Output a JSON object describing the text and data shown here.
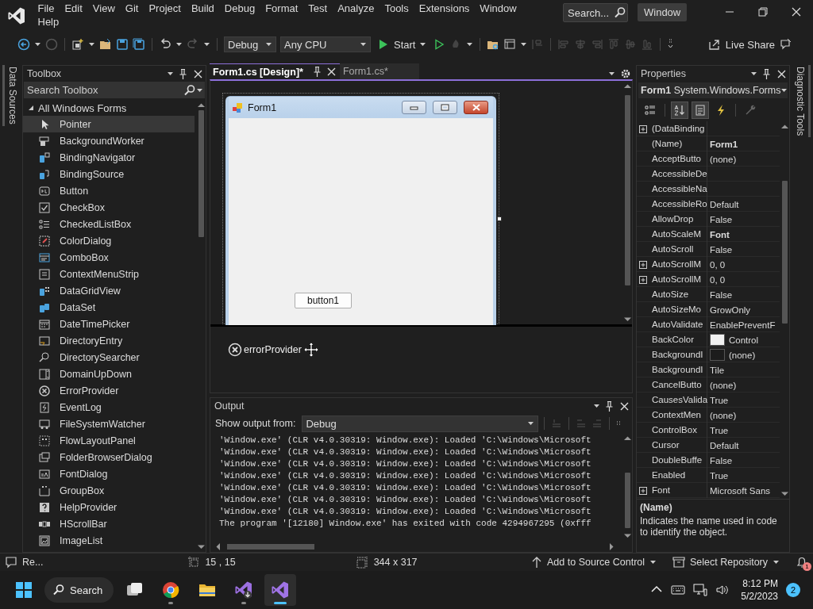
{
  "menu": [
    "File",
    "Edit",
    "View",
    "Git",
    "Project",
    "Build",
    "Debug",
    "Format",
    "Test",
    "Analyze",
    "Tools",
    "Extensions",
    "Window",
    "Help"
  ],
  "search": {
    "placeholder": "Search..."
  },
  "window_title": "Window",
  "toolbar": {
    "configuration": "Debug",
    "platform": "Any CPU",
    "start": "Start",
    "live_share": "Live Share"
  },
  "left_side_tabs": [
    "Data Sources"
  ],
  "right_side_tabs": [
    "Diagnostic Tools"
  ],
  "toolbox": {
    "title": "Toolbox",
    "search": {
      "placeholder": "Search Toolbox"
    },
    "group": {
      "label": "All Windows Forms",
      "expanded": true
    },
    "items": [
      {
        "label": "Pointer",
        "selected": true
      },
      {
        "label": "BackgroundWorker",
        "selected": false
      },
      {
        "label": "BindingNavigator",
        "selected": false
      },
      {
        "label": "BindingSource",
        "selected": false
      },
      {
        "label": "Button",
        "selected": false
      },
      {
        "label": "CheckBox",
        "selected": false
      },
      {
        "label": "CheckedListBox",
        "selected": false
      },
      {
        "label": "ColorDialog",
        "selected": false
      },
      {
        "label": "ComboBox",
        "selected": false
      },
      {
        "label": "ContextMenuStrip",
        "selected": false
      },
      {
        "label": "DataGridView",
        "selected": false
      },
      {
        "label": "DataSet",
        "selected": false
      },
      {
        "label": "DateTimePicker",
        "selected": false
      },
      {
        "label": "DirectoryEntry",
        "selected": false
      },
      {
        "label": "DirectorySearcher",
        "selected": false
      },
      {
        "label": "DomainUpDown",
        "selected": false
      },
      {
        "label": "ErrorProvider",
        "selected": false
      },
      {
        "label": "EventLog",
        "selected": false
      },
      {
        "label": "FileSystemWatcher",
        "selected": false
      },
      {
        "label": "FlowLayoutPanel",
        "selected": false
      },
      {
        "label": "FolderBrowserDialog",
        "selected": false
      },
      {
        "label": "FontDialog",
        "selected": false
      },
      {
        "label": "GroupBox",
        "selected": false
      },
      {
        "label": "HelpProvider",
        "selected": false
      },
      {
        "label": "HScrollBar",
        "selected": false
      },
      {
        "label": "ImageList",
        "selected": false
      }
    ]
  },
  "document_tabs": [
    {
      "label": "Form1.cs [Design]*",
      "selected": true
    },
    {
      "label": "Form1.cs*",
      "selected": false
    }
  ],
  "designer": {
    "form": {
      "title": "Form1",
      "button": "button1"
    },
    "components": [
      "errorProvider"
    ]
  },
  "output": {
    "title": "Output",
    "show_from_label": "Show output from:",
    "source": "Debug",
    "lines": [
      "'Window.exe' (CLR v4.0.30319: Window.exe): Loaded 'C:\\Windows\\Microsoft",
      "'Window.exe' (CLR v4.0.30319: Window.exe): Loaded 'C:\\Windows\\Microsoft",
      "'Window.exe' (CLR v4.0.30319: Window.exe): Loaded 'C:\\Windows\\Microsoft",
      "'Window.exe' (CLR v4.0.30319: Window.exe): Loaded 'C:\\Windows\\Microsoft",
      "'Window.exe' (CLR v4.0.30319: Window.exe): Loaded 'C:\\Windows\\Microsoft",
      "'Window.exe' (CLR v4.0.30319: Window.exe): Loaded 'C:\\Windows\\Microsoft",
      "'Window.exe' (CLR v4.0.30319: Window.exe): Loaded 'C:\\Windows\\Microsoft",
      "The program '[12180] Window.exe' has exited with code 4294967295 (0xfff"
    ]
  },
  "properties": {
    "title": "Properties",
    "object": "**Form1** System.Windows.Forms",
    "views": [
      {
        "kind": "categorized",
        "selected": false
      },
      {
        "kind": "alphabetical",
        "selected": true
      },
      {
        "kind": "properties",
        "selected": true
      },
      {
        "kind": "events",
        "selected": false
      },
      {
        "kind": "property-pages",
        "selected": false
      }
    ],
    "rows": [
      {
        "name": "(DataBinding",
        "value": "",
        "expandable": true
      },
      {
        "name": "(Name)",
        "value": "Form1",
        "expandable": false,
        "bold": true
      },
      {
        "name": "AcceptButto",
        "value": "(none)",
        "expandable": false,
        "bold": false
      },
      {
        "name": "AccessibleDe",
        "value": "",
        "expandable": false
      },
      {
        "name": "AccessibleNa",
        "value": "",
        "expandable": false
      },
      {
        "name": "AccessibleRo",
        "value": "Default",
        "expandable": false,
        "bold": false
      },
      {
        "name": "AllowDrop",
        "value": "False",
        "expandable": false,
        "bold": false
      },
      {
        "name": "AutoScaleM",
        "value": "Font",
        "expandable": false,
        "bold": true
      },
      {
        "name": "AutoScroll",
        "value": "False",
        "expandable": false,
        "bold": false
      },
      {
        "name": "AutoScrollM",
        "value": "0, 0",
        "expandable": true,
        "bold": false
      },
      {
        "name": "AutoScrollM",
        "value": "0, 0",
        "expandable": true,
        "bold": false
      },
      {
        "name": "AutoSize",
        "value": "False",
        "expandable": false,
        "bold": false
      },
      {
        "name": "AutoSizeMo",
        "value": "GrowOnly",
        "expandable": false,
        "bold": false
      },
      {
        "name": "AutoValidate",
        "value": "EnablePreventF",
        "expandable": false,
        "bold": false
      },
      {
        "name": "BackColor",
        "value": "Control",
        "expandable": false,
        "bold": false,
        "color": "#f0f0f0"
      },
      {
        "name": "BackgroundI",
        "value": "(none)",
        "expandable": false,
        "bold": false,
        "color": "#1c1c1c"
      },
      {
        "name": "BackgroundI",
        "value": "Tile",
        "expandable": false,
        "bold": false
      },
      {
        "name": "CancelButto",
        "value": "(none)",
        "expandable": false,
        "bold": false
      },
      {
        "name": "CausesValida",
        "value": "True",
        "expandable": false,
        "bold": false
      },
      {
        "name": "ContextMen",
        "value": "(none)",
        "expandable": false,
        "bold": false
      },
      {
        "name": "ControlBox",
        "value": "True",
        "expandable": false,
        "bold": false
      },
      {
        "name": "Cursor",
        "value": "Default",
        "expandable": false,
        "bold": false
      },
      {
        "name": "DoubleBuffe",
        "value": "False",
        "expandable": false,
        "bold": false
      },
      {
        "name": "Enabled",
        "value": "True",
        "expandable": false,
        "bold": false
      },
      {
        "name": "Font",
        "value": "Microsoft Sans",
        "expandable": true,
        "bold": false
      }
    ],
    "description_title": "(Name)",
    "description": "Indicates the name used in code to identify the object."
  },
  "status_bar": {
    "message": "Re...",
    "position": "15 , 15",
    "size": "344 x 317",
    "source_control": "Add to Source Control",
    "repository": "Select Repository",
    "notifications": "1"
  },
  "taskbar": {
    "search": "Search",
    "apps": [
      {
        "kind": "task-view",
        "running": false,
        "active": false
      },
      {
        "kind": "browser",
        "running": true,
        "active": false
      },
      {
        "kind": "folder",
        "running": false,
        "active": false
      },
      {
        "kind": "installer",
        "running": true,
        "active": false
      },
      {
        "kind": "visual-studio",
        "running": true,
        "active": true
      }
    ],
    "time": "8:12 PM",
    "date": "5/2/2023",
    "notifications": "2"
  }
}
